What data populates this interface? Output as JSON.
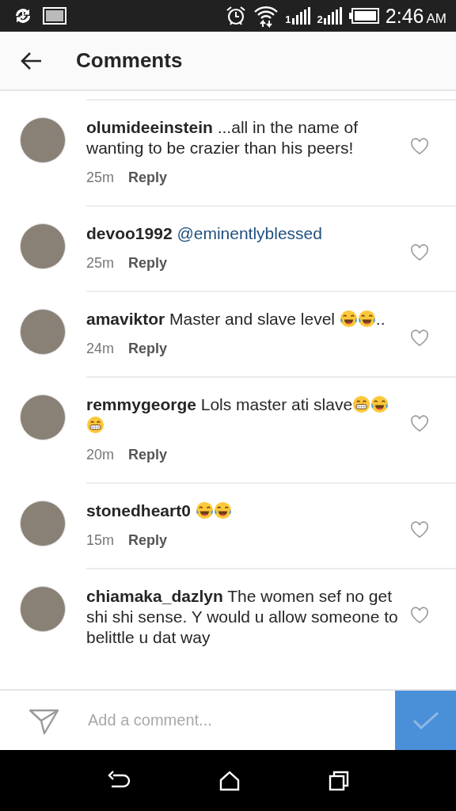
{
  "status_bar": {
    "time": "2:46",
    "meridiem": "AM",
    "sim_1": "1",
    "sim_2": "2"
  },
  "header": {
    "title": "Comments"
  },
  "comments": [
    {
      "username": "olumideeinstein",
      "body": [
        {
          "kind": "text",
          "text": "...all in the name of wanting to be crazier than his peers!"
        }
      ],
      "time": "25m",
      "reply": "Reply",
      "liked": false
    },
    {
      "username": "devoo1992",
      "body": [
        {
          "kind": "mention",
          "text": "@eminentlyblessed"
        }
      ],
      "time": "25m",
      "reply": "Reply",
      "liked": false
    },
    {
      "username": "amaviktor",
      "body": [
        {
          "kind": "text",
          "text": "Master and slave level "
        },
        {
          "kind": "joy"
        },
        {
          "kind": "joy"
        },
        {
          "kind": "text",
          "text": ".."
        }
      ],
      "time": "24m",
      "reply": "Reply",
      "liked": false
    },
    {
      "username": "remmygeorge",
      "body": [
        {
          "kind": "text",
          "text": "Lols master ati slave"
        },
        {
          "kind": "grin"
        },
        {
          "kind": "joy"
        },
        {
          "kind": "grin"
        }
      ],
      "time": "20m",
      "reply": "Reply",
      "liked": false
    },
    {
      "username": "stonedheart0",
      "body": [
        {
          "kind": "joy"
        },
        {
          "kind": "joy"
        }
      ],
      "time": "15m",
      "reply": "Reply",
      "liked": false
    },
    {
      "username": "chiamaka_dazlyn",
      "body": [
        {
          "kind": "text",
          "text": "The women sef no get shi shi sense. Y would u allow someone to belittle u dat way"
        }
      ],
      "liked": false
    }
  ],
  "composer": {
    "placeholder": "Add a comment..."
  }
}
